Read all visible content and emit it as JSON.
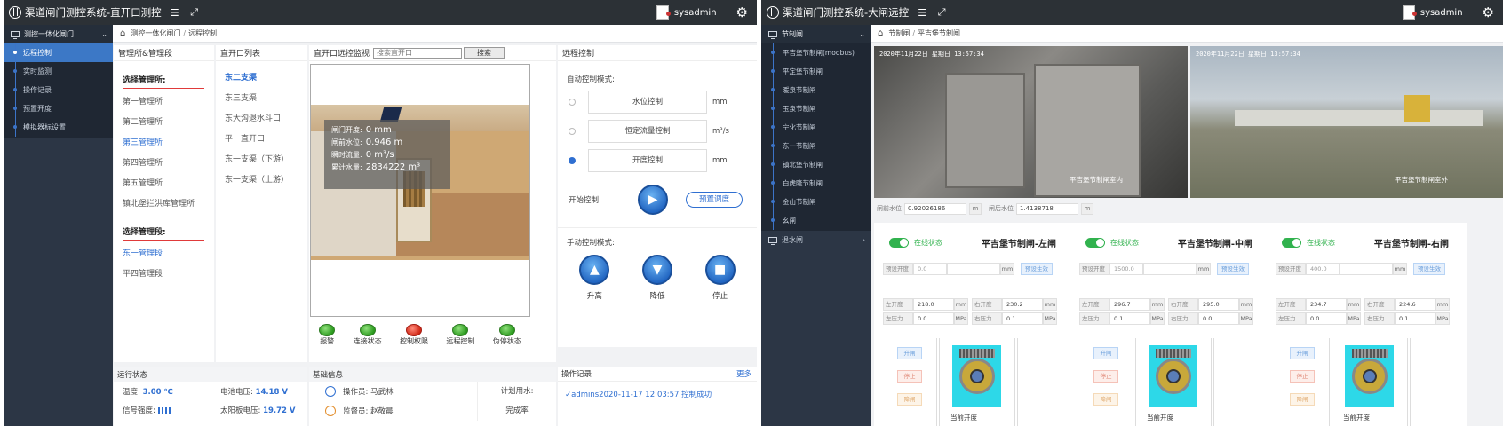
{
  "appA": {
    "title": "渠道闸门测控系统-直开口测控",
    "user": "sysadmin",
    "sidebar": {
      "group": "测控一体化闸门",
      "items": [
        {
          "label": "远程控制",
          "active": true
        },
        {
          "label": "实时监测"
        },
        {
          "label": "操作记录"
        },
        {
          "label": "预置开度"
        },
        {
          "label": "模拟器标设置"
        }
      ]
    },
    "breadcrumb": [
      "测控一体化闸门",
      "远程控制"
    ],
    "management": {
      "header": "管理所&管理段",
      "section1": "选择管理所:",
      "offices": [
        "第一管理所",
        "第二管理所",
        "第三管理所",
        "第四管理所",
        "第五管理所",
        "镇北堡拦洪库管理所"
      ],
      "section2": "选择管理段:",
      "segments": [
        "东一管理段",
        "平四管理段"
      ]
    },
    "gate_list": {
      "header": "直开口列表",
      "items": [
        "东二支渠",
        "东三支渠",
        "东大沟退水斗口",
        "平一直开口",
        "东一支渠（下游）",
        "东一支渠（上游）"
      ]
    },
    "monitor": {
      "header": "直开口远控监视",
      "search_placeholder": "搜索直开口",
      "search_btn": "搜索",
      "overlay": [
        {
          "label": "闸门开度:",
          "value": "0 mm"
        },
        {
          "label": "闸前水位:",
          "value": "0.946 m"
        },
        {
          "label": "瞬时流量:",
          "value": "0 m³/s"
        },
        {
          "label": "累计水量:",
          "value": "2834222 m³"
        }
      ],
      "lights": [
        {
          "label": "报警",
          "color": "green"
        },
        {
          "label": "连接状态",
          "color": "green"
        },
        {
          "label": "控制权限",
          "color": "red"
        },
        {
          "label": "远程控制",
          "color": "green"
        },
        {
          "label": "伪停状态",
          "color": "green"
        }
      ]
    },
    "control": {
      "header": "远程控制",
      "auto_label": "自动控制模式:",
      "modes": [
        {
          "label": "水位控制",
          "unit": "mm",
          "selected": false
        },
        {
          "label": "恒定流量控制",
          "unit": "m³/s",
          "selected": false
        },
        {
          "label": "开度控制",
          "unit": "mm",
          "selected": true
        }
      ],
      "start_label": "开始控制:",
      "preset_label": "预置调度",
      "manual_label": "手动控制模式:",
      "manual": [
        {
          "label": "升高",
          "icon": "arrow-up"
        },
        {
          "label": "降低",
          "icon": "arrow-down"
        },
        {
          "label": "停止",
          "icon": "stop"
        }
      ]
    },
    "status": {
      "header": "运行状态",
      "temp_label": "温度:",
      "temp": "3.00 ℃",
      "battery_label": "电池电压:",
      "battery": "14.18 V",
      "signal_label": "信号强度:",
      "solar_label": "太阳板电压:",
      "solar": "19.72 V"
    },
    "basic": {
      "header": "基础信息",
      "operator_label": "操作员:",
      "operator": "马武林",
      "supervisor_label": "监督员:",
      "supervisor": "赵敬晨",
      "plan_label": "计划用水:",
      "rate_label": "完成率"
    },
    "log": {
      "header": "操作记录",
      "more": "更多",
      "entry": "admins2020-11-17 12:03:57 控制成功"
    }
  },
  "appB": {
    "title": "渠道闸门测控系统-大闸远控",
    "user": "sysadmin",
    "sidebar": {
      "group": "节制闸",
      "items": [
        "平吉堡节制闸(modbus)",
        "平定堡节制闸",
        "暖泉节制闸",
        "玉泉节制闸",
        "宁化节制闸",
        "东一节制闸",
        "镇北堡节制闸",
        "白虎隆节制闸",
        "金山节制闸",
        "幺闸"
      ],
      "group2": "退水闸"
    },
    "breadcrumb": [
      "节制闸",
      "平吉堡节制闸"
    ],
    "cams": [
      {
        "ts": "2020年11月22日 星期日 13:57:34",
        "label": "平吉堡节制闸室内"
      },
      {
        "ts": "2020年11月22日 星期日 13:57:34",
        "label": "平吉堡节制闸室外"
      }
    ],
    "levels": [
      {
        "label": "闸前水位",
        "value": "0.92026186",
        "unit": "m"
      },
      {
        "label": "闸后水位",
        "value": "1.4138718",
        "unit": "m"
      }
    ],
    "gates": [
      {
        "title": "平吉堡节制闸-左闸",
        "online": "在线状态",
        "preset_label": "预设开度",
        "preset": "0.0",
        "preset_unit": "mm",
        "preset_btn": "预设生效",
        "left_open": "218.0",
        "right_open": "230.2",
        "left_press": "0.0",
        "right_press": "0.1"
      },
      {
        "title": "平吉堡节制闸-中闸",
        "online": "在线状态",
        "preset_label": "预设开度",
        "preset": "1500.0",
        "preset_unit": "mm",
        "preset_btn": "预设生效",
        "left_open": "296.7",
        "right_open": "295.0",
        "left_press": "0.1",
        "right_press": "0.0"
      },
      {
        "title": "平吉堡节制闸-右闸",
        "online": "在线状态",
        "preset_label": "预设开度",
        "preset": "400.0",
        "preset_unit": "mm",
        "preset_btn": "预设生效",
        "left_open": "234.7",
        "right_open": "224.6",
        "left_press": "0.0",
        "right_press": "0.1"
      }
    ],
    "gate_labels": {
      "left_open": "左开度",
      "right_open": "右开度",
      "left_press": "左压力",
      "right_press": "右压力",
      "mm": "mm",
      "mpa": "MPa",
      "raise": "升闸",
      "stop": "停止",
      "lower": "降闸",
      "cur": "当前开度"
    }
  }
}
